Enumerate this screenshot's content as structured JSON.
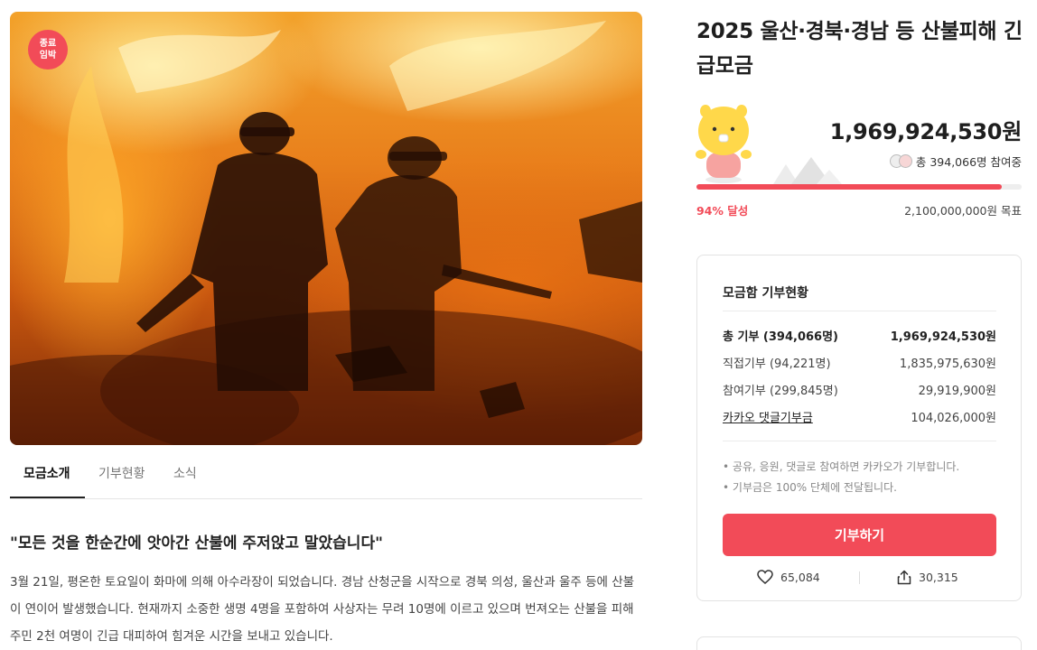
{
  "hero": {
    "badge_line1": "종료",
    "badge_line2": "임박",
    "badge_color": "#f24b58"
  },
  "tabs": [
    {
      "label": "모금소개",
      "active": true
    },
    {
      "label": "기부현황",
      "active": false
    },
    {
      "label": "소식",
      "active": false
    }
  ],
  "story": {
    "headline": "\"모든 것을 한순간에 앗아간 산불에 주저앉고 말았습니다\"",
    "paragraph": "3월 21일, 평온한 토요일이 화마에 의해 아수라장이 되었습니다. 경남 산청군을 시작으로 경북 의성, 울산과 울주 등에 산불이 연이어 발생했습니다. 현재까지 소중한 생명 4명을 포함하여 사상자는 무려 10명에 이르고 있으며 번져오는 산불을 피해 주민 2천 여명이 긴급 대피하여 힘겨운 시간을 보내고 있습니다."
  },
  "campaign": {
    "title": "2025 울산·경북·경남 등 산불피해 긴급모금",
    "amount": "1,969,924,530원",
    "participants": "총 394,066명 참여중",
    "progress_fraction": 0.94,
    "percent_label": "94% 달성",
    "goal": "2,100,000,000원 목표",
    "accent_color": "#f24b58"
  },
  "status_card": {
    "title": "모금함 기부현황",
    "rows": [
      {
        "label": "총 기부 (394,066명)",
        "value": "1,969,924,530원"
      },
      {
        "label": "직접기부 (94,221명)",
        "value": "1,835,975,630원"
      },
      {
        "label": "참여기부 (299,845명)",
        "value": "29,919,900원"
      },
      {
        "label": "카카오 댓글기부금",
        "value": "104,026,000원"
      }
    ],
    "notes": [
      "공유, 응원, 댓글로 참여하면 카카오가 기부합니다.",
      "기부금은 100% 단체에 전달됩니다."
    ],
    "donate_label": "기부하기",
    "likes": "65,084",
    "shares": "30,315"
  }
}
